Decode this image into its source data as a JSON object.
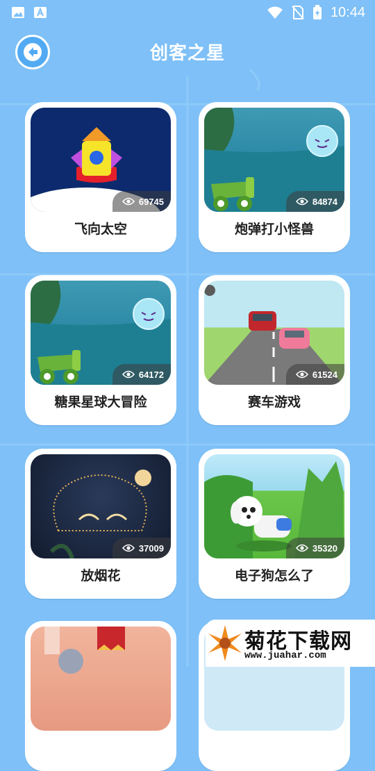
{
  "status_bar": {
    "time": "10:44"
  },
  "header": {
    "title": "创客之星"
  },
  "cards": [
    {
      "label": "飞向太空",
      "views": "69745"
    },
    {
      "label": "炮弹打小怪兽",
      "views": "84874"
    },
    {
      "label": "糖果星球大冒险",
      "views": "64172"
    },
    {
      "label": "赛车游戏",
      "views": "61524"
    },
    {
      "label": "放烟花",
      "views": "37009"
    },
    {
      "label": "电子狗怎么了",
      "views": "35320"
    }
  ],
  "watermark": {
    "title": "菊花下载网",
    "url": "www.juahar.com"
  },
  "colors": {
    "background": "#7ec0f7",
    "button": "#52aaf3",
    "card": "#ffffff"
  }
}
